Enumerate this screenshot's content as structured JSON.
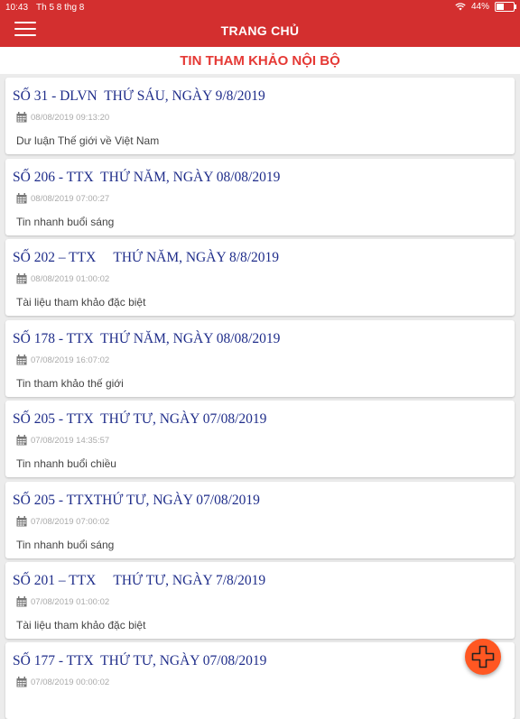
{
  "status_bar": {
    "time": "10:43",
    "date": "Th 5 8 thg 8",
    "battery": "44%"
  },
  "header": {
    "title": "TRANG CHỦ"
  },
  "section": {
    "title": "TIN THAM KHẢO NỘI BỘ"
  },
  "articles": [
    {
      "title": "SỐ 31 - DLVN  THỨ SÁU, NGÀY 9/8/2019",
      "timestamp": "08/08/2019 09:13:20",
      "description": "Dư luận Thế giới về Việt Nam"
    },
    {
      "title": "SỐ 206 - TTX  THỨ NĂM, NGÀY 08/08/2019",
      "timestamp": "08/08/2019 07:00:27",
      "description": "Tin nhanh buổi sáng"
    },
    {
      "title": "SỐ 202 – TTX     THỨ NĂM, NGÀY 8/8/2019",
      "timestamp": "08/08/2019 01:00:02",
      "description": "Tài liệu tham khảo đặc biệt"
    },
    {
      "title": "SỐ 178 - TTX  THỨ NĂM, NGÀY 08/08/2019",
      "timestamp": "07/08/2019 16:07:02",
      "description": "Tin tham khảo thế giới"
    },
    {
      "title": "SỐ 205 - TTX  THỨ TƯ, NGÀY 07/08/2019",
      "timestamp": "07/08/2019 14:35:57",
      "description": "Tin nhanh buổi chiều"
    },
    {
      "title": "SỐ 205 - TTXTHỨ TƯ, NGÀY 07/08/2019",
      "timestamp": "07/08/2019 07:00:02",
      "description": "Tin nhanh buổi sáng"
    },
    {
      "title": "SỐ 201 – TTX     THỨ TƯ, NGÀY 7/8/2019",
      "timestamp": "07/08/2019 01:00:02",
      "description": "Tài liệu tham khảo đặc biệt"
    },
    {
      "title": "SỐ 177 - TTX  THỨ TƯ, NGÀY 07/08/2019",
      "timestamp": "07/08/2019 00:00:02",
      "description": ""
    }
  ],
  "colors": {
    "header_bg": "#d32f2f",
    "section_title": "#e53935",
    "article_title": "#1f2d8a",
    "fab": "#ff5722"
  },
  "icons": {
    "menu": "hamburger-menu-icon",
    "calendar": "calendar-icon",
    "fab": "plus-icon"
  }
}
